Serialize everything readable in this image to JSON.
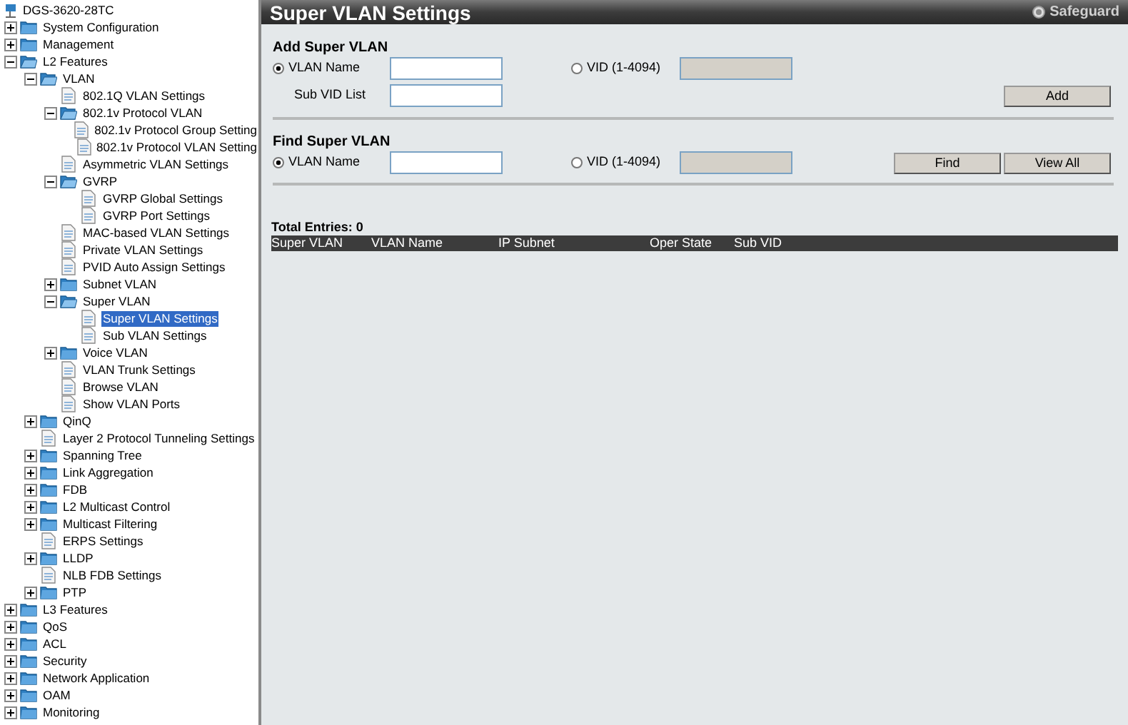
{
  "tree": {
    "label": "DGS-3620-28TC",
    "children": [
      {
        "label": "System Configuration",
        "kind": "folder",
        "expanded": false,
        "selected": false
      },
      {
        "label": "Management",
        "kind": "folder",
        "expanded": false,
        "selected": false
      },
      {
        "label": "L2 Features",
        "kind": "folder",
        "expanded": true,
        "selected": false,
        "children": [
          {
            "label": "VLAN",
            "kind": "folder",
            "expanded": true,
            "selected": false,
            "children": [
              {
                "label": "802.1Q VLAN Settings",
                "kind": "page",
                "selected": false
              },
              {
                "label": "802.1v Protocol VLAN",
                "kind": "folder",
                "expanded": true,
                "selected": false,
                "children": [
                  {
                    "label": "802.1v Protocol Group Setting",
                    "kind": "page",
                    "selected": false
                  },
                  {
                    "label": "802.1v Protocol VLAN Setting",
                    "kind": "page",
                    "selected": false
                  }
                ]
              },
              {
                "label": "Asymmetric VLAN Settings",
                "kind": "page",
                "selected": false
              },
              {
                "label": "GVRP",
                "kind": "folder",
                "expanded": true,
                "selected": false,
                "children": [
                  {
                    "label": "GVRP Global Settings",
                    "kind": "page",
                    "selected": false
                  },
                  {
                    "label": "GVRP Port Settings",
                    "kind": "page",
                    "selected": false
                  }
                ]
              },
              {
                "label": "MAC-based VLAN Settings",
                "kind": "page",
                "selected": false
              },
              {
                "label": "Private VLAN Settings",
                "kind": "page",
                "selected": false
              },
              {
                "label": "PVID Auto Assign Settings",
                "kind": "page",
                "selected": false
              },
              {
                "label": "Subnet VLAN",
                "kind": "folder",
                "expanded": false,
                "selected": false
              },
              {
                "label": "Super VLAN",
                "kind": "folder",
                "expanded": true,
                "selected": false,
                "children": [
                  {
                    "label": "Super VLAN Settings",
                    "kind": "page",
                    "selected": true
                  },
                  {
                    "label": "Sub VLAN Settings",
                    "kind": "page",
                    "selected": false
                  }
                ]
              },
              {
                "label": "Voice VLAN",
                "kind": "folder",
                "expanded": false,
                "selected": false
              },
              {
                "label": "VLAN Trunk Settings",
                "kind": "page",
                "selected": false
              },
              {
                "label": "Browse VLAN",
                "kind": "page",
                "selected": false
              },
              {
                "label": "Show VLAN Ports",
                "kind": "page",
                "selected": false
              }
            ]
          },
          {
            "label": "QinQ",
            "kind": "folder",
            "expanded": false,
            "selected": false
          },
          {
            "label": "Layer 2 Protocol Tunneling Settings",
            "kind": "page",
            "selected": false
          },
          {
            "label": "Spanning Tree",
            "kind": "folder",
            "expanded": false,
            "selected": false
          },
          {
            "label": "Link Aggregation",
            "kind": "folder",
            "expanded": false,
            "selected": false
          },
          {
            "label": "FDB",
            "kind": "folder",
            "expanded": false,
            "selected": false
          },
          {
            "label": "L2 Multicast Control",
            "kind": "folder",
            "expanded": false,
            "selected": false
          },
          {
            "label": "Multicast Filtering",
            "kind": "folder",
            "expanded": false,
            "selected": false
          },
          {
            "label": "ERPS Settings",
            "kind": "page",
            "selected": false
          },
          {
            "label": "LLDP",
            "kind": "folder",
            "expanded": false,
            "selected": false
          },
          {
            "label": "NLB FDB Settings",
            "kind": "page",
            "selected": false
          },
          {
            "label": "PTP",
            "kind": "folder",
            "expanded": false,
            "selected": false
          }
        ]
      },
      {
        "label": "L3 Features",
        "kind": "folder",
        "expanded": false,
        "selected": false
      },
      {
        "label": "QoS",
        "kind": "folder",
        "expanded": false,
        "selected": false
      },
      {
        "label": "ACL",
        "kind": "folder",
        "expanded": false,
        "selected": false
      },
      {
        "label": "Security",
        "kind": "folder",
        "expanded": false,
        "selected": false
      },
      {
        "label": "Network Application",
        "kind": "folder",
        "expanded": false,
        "selected": false
      },
      {
        "label": "OAM",
        "kind": "folder",
        "expanded": false,
        "selected": false
      },
      {
        "label": "Monitoring",
        "kind": "folder",
        "expanded": false,
        "selected": false
      }
    ]
  },
  "header": {
    "title": "Super VLAN Settings",
    "safeguard": "Safeguard"
  },
  "add_section": {
    "title": "Add Super VLAN",
    "name_radio": {
      "label": "VLAN Name",
      "selected": true
    },
    "vid_radio": {
      "label": "VID (1-4094)",
      "selected": false
    },
    "sub_vid_label": "Sub VID List",
    "button": "Add"
  },
  "find_section": {
    "title": "Find Super VLAN",
    "name_radio": {
      "label": "VLAN Name",
      "selected": true
    },
    "vid_radio": {
      "label": "VID (1-4094)",
      "selected": false
    },
    "buttons": [
      "Find",
      "View All"
    ]
  },
  "total_entries": "Total Entries: 0",
  "table": {
    "columns": [
      "Super VLAN",
      "VLAN Name",
      "IP Subnet",
      "Oper State",
      "Sub VID"
    ]
  }
}
